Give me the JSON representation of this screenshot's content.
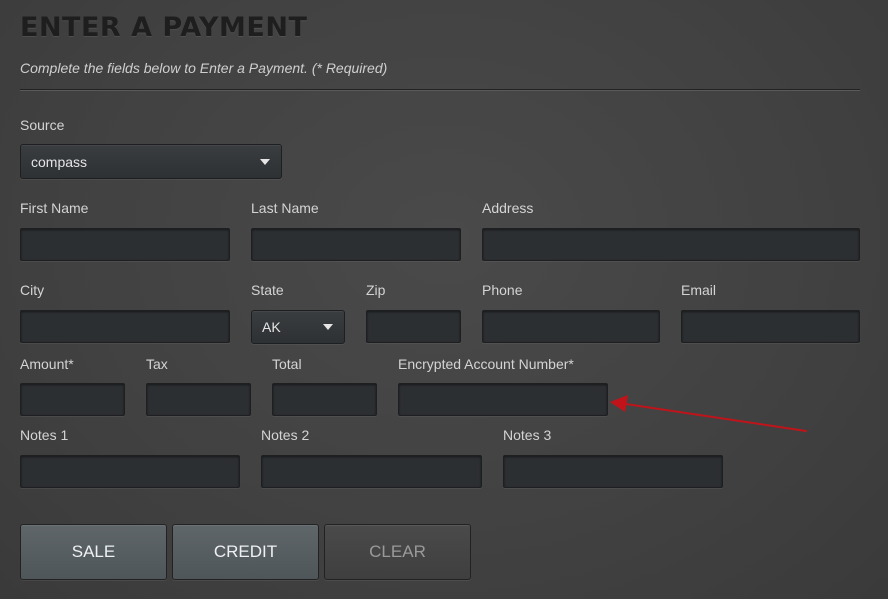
{
  "page": {
    "title": "ENTER A PAYMENT",
    "subtitle": "Complete the fields below to Enter a Payment. (* Required)"
  },
  "source": {
    "label": "Source",
    "selected": "compass"
  },
  "fields": {
    "first_name": {
      "label": "First Name",
      "value": ""
    },
    "last_name": {
      "label": "Last Name",
      "value": ""
    },
    "address": {
      "label": "Address",
      "value": ""
    },
    "city": {
      "label": "City",
      "value": ""
    },
    "state": {
      "label": "State",
      "selected": "AK"
    },
    "zip": {
      "label": "Zip",
      "value": ""
    },
    "phone": {
      "label": "Phone",
      "value": ""
    },
    "email": {
      "label": "Email",
      "value": ""
    },
    "amount": {
      "label": "Amount*",
      "value": ""
    },
    "tax": {
      "label": "Tax",
      "value": ""
    },
    "total": {
      "label": "Total",
      "value": ""
    },
    "encrypted_account": {
      "label": "Encrypted Account Number*",
      "value": ""
    },
    "notes1": {
      "label": "Notes 1",
      "value": ""
    },
    "notes2": {
      "label": "Notes 2",
      "value": ""
    },
    "notes3": {
      "label": "Notes 3",
      "value": ""
    }
  },
  "buttons": {
    "sale": "SALE",
    "credit": "CREDIT",
    "clear": "CLEAR"
  },
  "colors": {
    "annotation_arrow": "#c0141a",
    "primary_button": "#586064",
    "background": "#444444"
  }
}
